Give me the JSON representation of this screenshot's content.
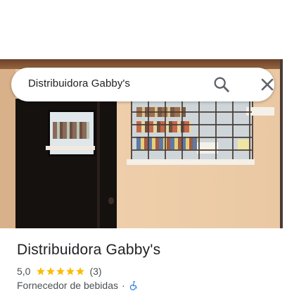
{
  "search": {
    "query": "Distribuidora Gabby's"
  },
  "place": {
    "name": "Distribuidora Gabby's",
    "rating": "5,0",
    "stars": 5,
    "review_count": "(3)",
    "category": "Fornecedor de bebidas",
    "separator": "·",
    "accessibility_icon": "wheelchair-icon"
  },
  "icons": {
    "search": "search-icon",
    "close": "close-icon",
    "star": "star-icon"
  },
  "colors": {
    "star": "#fbbc04",
    "accessible": "#1a73e8",
    "text_primary": "#202124",
    "text_secondary": "#4d5156"
  }
}
